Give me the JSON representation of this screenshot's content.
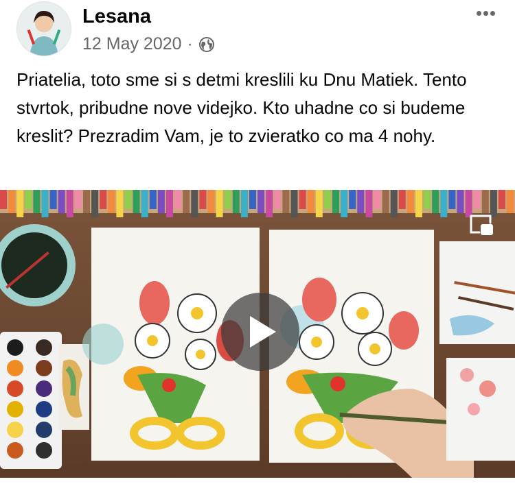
{
  "post": {
    "author": "Lesana",
    "date": "12 May 2020",
    "separator": "·",
    "privacy_icon": "globe-icon",
    "more_icon": "more-options-icon",
    "text": "Priatelia, toto sme si s detmi kreslili ku Dnu Matiek. Tento stvrtok, pribudne nove videjko. Kto uhadne co si budeme kreslit? Prezradim Vam, je to zvieratko co ma 4 nohy."
  },
  "video": {
    "play_icon": "play-icon",
    "pip_icon": "picture-in-picture-icon"
  },
  "colors": {
    "author_text": "#050505",
    "meta_text": "#65676b",
    "table_wood": "#6e4b34",
    "paper": "#f6f4ef"
  }
}
